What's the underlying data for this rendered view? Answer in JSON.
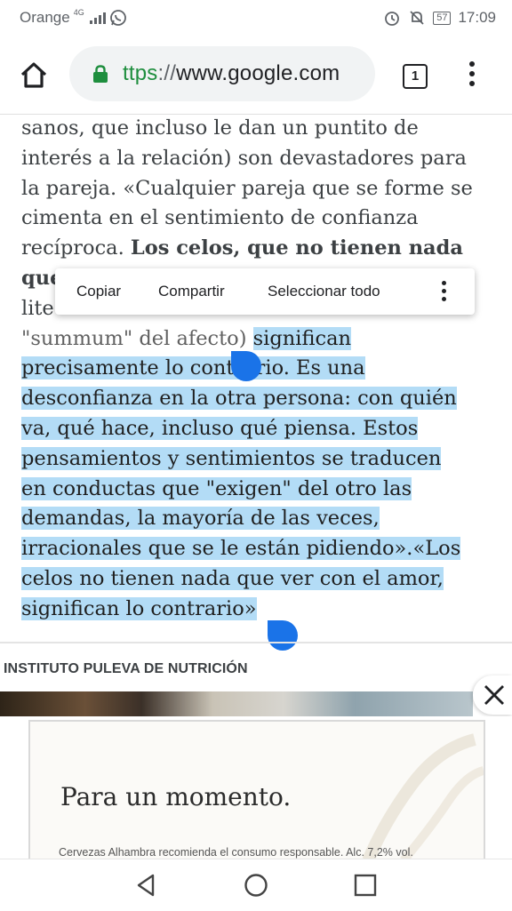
{
  "status": {
    "carrier": "Orange",
    "network": "4G",
    "battery": "57",
    "time": "17:09"
  },
  "browser": {
    "url_scheme": "ttps",
    "url_sep": "://",
    "url_host": "www.google.com",
    "tab_count": "1"
  },
  "article": {
    "lines": [
      {
        "parts": [
          {
            "t": "sanos, que incluso le dan un puntito de"
          }
        ]
      },
      {
        "parts": [
          {
            "t": "interés a la relación) son devastadores para"
          }
        ]
      },
      {
        "parts": [
          {
            "t": "la pareja. «Cualquier pareja que se forme se"
          }
        ]
      },
      {
        "parts": [
          {
            "t": "cimenta en el sentimiento de confianza"
          }
        ]
      },
      {
        "parts": [
          {
            "t": "recíproca. "
          },
          {
            "t": "Los celos, que no tienen nada",
            "b": true
          }
        ]
      },
      {
        "parts": [
          {
            "t": "que",
            "b": true
          }
        ]
      },
      {
        "parts": [
          {
            "t": "lite"
          }
        ]
      },
      {
        "parts": [
          {
            "t": "\"summum\" del afecto) ",
            "g": true
          },
          {
            "t": "significan",
            "h": true
          }
        ]
      },
      {
        "parts": [
          {
            "t": "precisamente lo contrario. Es una",
            "h": true
          }
        ]
      },
      {
        "parts": [
          {
            "t": "desconfianza en la otra persona: con quién",
            "h": true
          }
        ]
      },
      {
        "parts": [
          {
            "t": "va, qué hace, incluso qué piensa. Estos",
            "h": true
          }
        ]
      },
      {
        "parts": [
          {
            "t": "pensamientos y sentimientos se traducen",
            "h": true
          }
        ]
      },
      {
        "parts": [
          {
            "t": "en conductas que \"exigen\" del otro las",
            "h": true
          }
        ]
      },
      {
        "parts": [
          {
            "t": "demandas, la mayoría de las veces,",
            "h": true
          }
        ]
      },
      {
        "parts": [
          {
            "t": "irracionales que se le están pidiendo».«Los",
            "h": true
          }
        ]
      },
      {
        "parts": [
          {
            "t": "celos no tienen nada que ver con el amor,",
            "h": true
          }
        ]
      },
      {
        "parts": [
          {
            "t": "significan lo contrario»",
            "h": true
          }
        ]
      }
    ]
  },
  "popup": {
    "copy": "Copiar",
    "share": "Compartir",
    "select_all": "Seleccionar todo"
  },
  "section_title": "INSTITUTO PULEVA DE NUTRICIÓN",
  "ad": {
    "headline": "Para un momento.",
    "disclaimer": "Cervezas Alhambra recomienda el consumo responsable. Alc. 7,2% vol."
  }
}
